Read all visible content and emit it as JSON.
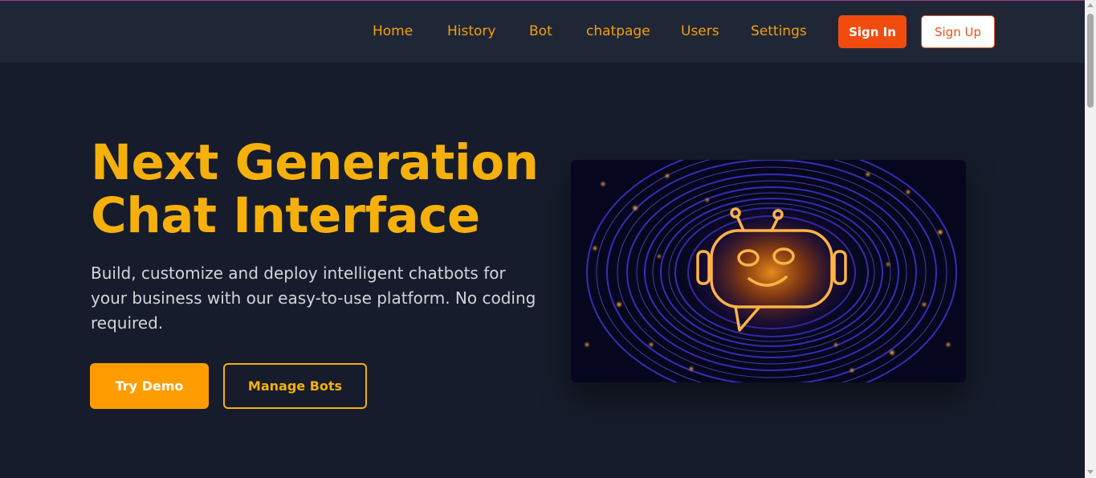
{
  "nav": {
    "links": [
      "Home",
      "History",
      "Bot",
      "chatpage",
      "Users",
      "Settings"
    ],
    "sign_in": "Sign In",
    "sign_up": "Sign Up"
  },
  "hero": {
    "title_line1": "Next Generation",
    "title_line2": "Chat Interface",
    "subtitle": "Build, customize and deploy intelligent chatbots for your business with our easy-to-use platform. No coding required.",
    "try_demo": "Try Demo",
    "manage_bots": "Manage Bots"
  },
  "colors": {
    "accent": "#f5b00b",
    "sign_in_bg": "#f04c10",
    "background": "#161c2b",
    "navbar_bg": "#1f2736"
  },
  "icons": {
    "hero_image": "robot-chat-bubble-icon"
  }
}
